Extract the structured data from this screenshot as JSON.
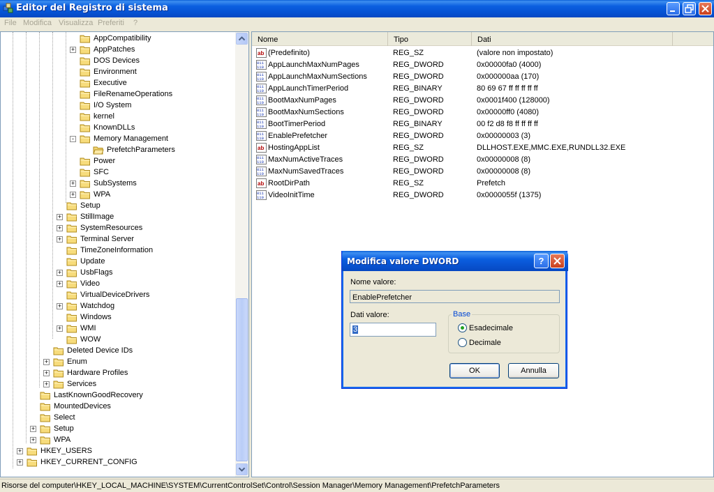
{
  "window": {
    "title": "Editor del Registro di sistema"
  },
  "menu": [
    "File",
    "Modifica",
    "Visualizza",
    "Preferiti",
    "?"
  ],
  "tree": {
    "items": [
      {
        "label": "AppCompatibility",
        "level": 5,
        "expander": ""
      },
      {
        "label": "AppPatches",
        "level": 5,
        "expander": "+"
      },
      {
        "label": "DOS Devices",
        "level": 5,
        "expander": ""
      },
      {
        "label": "Environment",
        "level": 5,
        "expander": ""
      },
      {
        "label": "Executive",
        "level": 5,
        "expander": ""
      },
      {
        "label": "FileRenameOperations",
        "level": 5,
        "expander": ""
      },
      {
        "label": "I/O System",
        "level": 5,
        "expander": ""
      },
      {
        "label": "kernel",
        "level": 5,
        "expander": ""
      },
      {
        "label": "KnownDLLs",
        "level": 5,
        "expander": ""
      },
      {
        "label": "Memory Management",
        "level": 5,
        "expander": "-"
      },
      {
        "label": "PrefetchParameters",
        "level": 6,
        "expander": "",
        "open": true
      },
      {
        "label": "Power",
        "level": 5,
        "expander": ""
      },
      {
        "label": "SFC",
        "level": 5,
        "expander": ""
      },
      {
        "label": "SubSystems",
        "level": 5,
        "expander": "+"
      },
      {
        "label": "WPA",
        "level": 5,
        "expander": "+"
      },
      {
        "label": "Setup",
        "level": 4,
        "expander": ""
      },
      {
        "label": "StillImage",
        "level": 4,
        "expander": "+"
      },
      {
        "label": "SystemResources",
        "level": 4,
        "expander": "+"
      },
      {
        "label": "Terminal Server",
        "level": 4,
        "expander": "+"
      },
      {
        "label": "TimeZoneInformation",
        "level": 4,
        "expander": ""
      },
      {
        "label": "Update",
        "level": 4,
        "expander": ""
      },
      {
        "label": "UsbFlags",
        "level": 4,
        "expander": "+"
      },
      {
        "label": "Video",
        "level": 4,
        "expander": "+"
      },
      {
        "label": "VirtualDeviceDrivers",
        "level": 4,
        "expander": ""
      },
      {
        "label": "Watchdog",
        "level": 4,
        "expander": "+"
      },
      {
        "label": "Windows",
        "level": 4,
        "expander": ""
      },
      {
        "label": "WMI",
        "level": 4,
        "expander": "+"
      },
      {
        "label": "WOW",
        "level": 4,
        "expander": ""
      },
      {
        "label": "Deleted Device IDs",
        "level": 3,
        "expander": ""
      },
      {
        "label": "Enum",
        "level": 3,
        "expander": "+"
      },
      {
        "label": "Hardware Profiles",
        "level": 3,
        "expander": "+"
      },
      {
        "label": "Services",
        "level": 3,
        "expander": "+"
      },
      {
        "label": "LastKnownGoodRecovery",
        "level": 2,
        "expander": ""
      },
      {
        "label": "MountedDevices",
        "level": 2,
        "expander": ""
      },
      {
        "label": "Select",
        "level": 2,
        "expander": ""
      },
      {
        "label": "Setup",
        "level": 2,
        "expander": "+"
      },
      {
        "label": "WPA",
        "level": 2,
        "expander": "+"
      },
      {
        "label": "HKEY_USERS",
        "level": 1,
        "expander": "+"
      },
      {
        "label": "HKEY_CURRENT_CONFIG",
        "level": 1,
        "expander": "+"
      }
    ]
  },
  "list": {
    "columns": [
      "Nome",
      "Tipo",
      "Dati"
    ],
    "rows": [
      {
        "icon": "string-value-icon",
        "name": "(Predefinito)",
        "type": "REG_SZ",
        "data": "(valore non impostato)"
      },
      {
        "icon": "binary-value-icon",
        "name": "AppLaunchMaxNumPages",
        "type": "REG_DWORD",
        "data": "0x00000fa0 (4000)"
      },
      {
        "icon": "binary-value-icon",
        "name": "AppLaunchMaxNumSections",
        "type": "REG_DWORD",
        "data": "0x000000aa (170)"
      },
      {
        "icon": "binary-value-icon",
        "name": "AppLaunchTimerPeriod",
        "type": "REG_BINARY",
        "data": "80 69 67 ff ff ff ff ff"
      },
      {
        "icon": "binary-value-icon",
        "name": "BootMaxNumPages",
        "type": "REG_DWORD",
        "data": "0x0001f400 (128000)"
      },
      {
        "icon": "binary-value-icon",
        "name": "BootMaxNumSections",
        "type": "REG_DWORD",
        "data": "0x00000ff0 (4080)"
      },
      {
        "icon": "binary-value-icon",
        "name": "BootTimerPeriod",
        "type": "REG_BINARY",
        "data": "00 f2 d8 f8 ff ff ff ff"
      },
      {
        "icon": "binary-value-icon",
        "name": "EnablePrefetcher",
        "type": "REG_DWORD",
        "data": "0x00000003 (3)"
      },
      {
        "icon": "string-value-icon",
        "name": "HostingAppList",
        "type": "REG_SZ",
        "data": "DLLHOST.EXE,MMC.EXE,RUNDLL32.EXE"
      },
      {
        "icon": "binary-value-icon",
        "name": "MaxNumActiveTraces",
        "type": "REG_DWORD",
        "data": "0x00000008 (8)"
      },
      {
        "icon": "binary-value-icon",
        "name": "MaxNumSavedTraces",
        "type": "REG_DWORD",
        "data": "0x00000008 (8)"
      },
      {
        "icon": "string-value-icon",
        "name": "RootDirPath",
        "type": "REG_SZ",
        "data": "Prefetch"
      },
      {
        "icon": "binary-value-icon",
        "name": "VideoInitTime",
        "type": "REG_DWORD",
        "data": "0x0000055f (1375)"
      }
    ]
  },
  "status": {
    "path": "Risorse del computer\\HKEY_LOCAL_MACHINE\\SYSTEM\\CurrentControlSet\\Control\\Session Manager\\Memory Management\\PrefetchParameters"
  },
  "dialog": {
    "title": "Modifica valore DWORD",
    "help_label": "?",
    "value_name_label": "Nome valore:",
    "value_name": "EnablePrefetcher",
    "value_data_label": "Dati valore:",
    "value_data": "3",
    "base_label": "Base",
    "radio_hex": "Esadecimale",
    "radio_dec": "Decimale",
    "selected_base": "hex",
    "ok": "OK",
    "cancel": "Annulla"
  }
}
